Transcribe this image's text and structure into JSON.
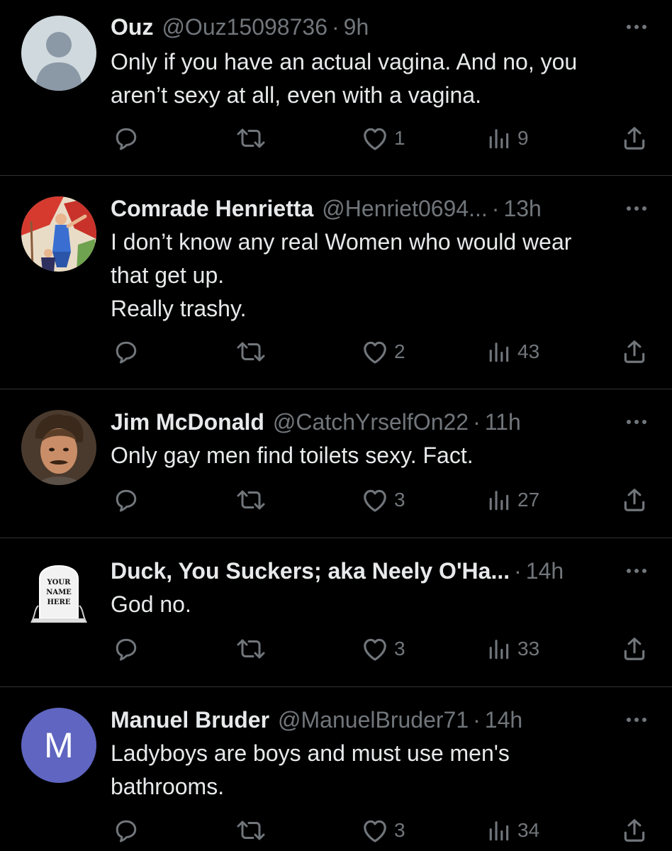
{
  "colors": {
    "background": "#000000",
    "primary_text": "#e7e9ea",
    "secondary_text": "#71767b",
    "divider": "#2f3336",
    "avatar_default": "#cfd9de",
    "avatar_m_bg": "#5f65c0"
  },
  "icons": [
    "reply-icon",
    "retweet-icon",
    "like-icon",
    "views-icon",
    "share-icon",
    "more-icon"
  ],
  "tweets": [
    {
      "name": "Ouz",
      "handle": "@Ouz15098736",
      "separator": "·",
      "time": "9h",
      "lines": [
        "Only if you have an actual vagina. And no, you",
        "aren’t sexy at all, even with a vagina."
      ],
      "likes": "1",
      "views": "9",
      "avatar": "default-profile-avatar"
    },
    {
      "name": "Comrade Henrietta",
      "handle": "@Henriet0694...",
      "separator": "·",
      "time": "13h",
      "lines": [
        "I don’t know any real Women who would wear",
        "that get up.",
        "Really trashy."
      ],
      "likes": "2",
      "views": "43",
      "avatar": "poster-art-avatar"
    },
    {
      "name": "Jim McDonald",
      "handle": "@CatchYrselfOn22",
      "separator": "·",
      "time": "11h",
      "lines": [
        "Only gay men find toilets sexy. Fact."
      ],
      "likes": "3",
      "views": "27",
      "avatar": "photo-avatar"
    },
    {
      "name": "Duck, You Suckers; aka Neely O'Ha...",
      "handle": "",
      "separator": "·",
      "time": "14h",
      "lines": [
        "God no."
      ],
      "likes": "3",
      "views": "33",
      "avatar": "tombstone-avatar",
      "avatar_text": [
        "YOUR",
        "NAME",
        "HERE"
      ]
    },
    {
      "name": "Manuel Bruder",
      "handle": "@ManuelBruder71",
      "separator": "·",
      "time": "14h",
      "lines": [
        "Ladyboys are boys and must use men's",
        "bathrooms."
      ],
      "likes": "3",
      "views": "34",
      "avatar": "letter-avatar",
      "avatar_letter": "M"
    }
  ]
}
